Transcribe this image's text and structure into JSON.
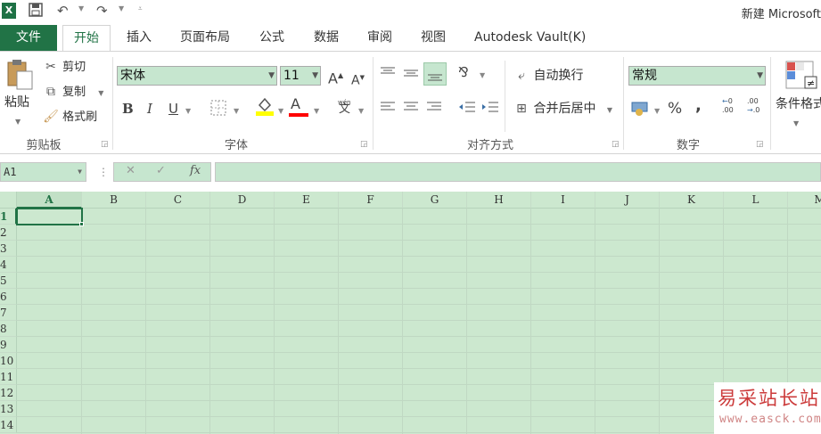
{
  "titlebar": {
    "logo": "X",
    "title": "新建 Microsoft"
  },
  "tabs": {
    "file": "文件",
    "items": [
      "开始",
      "插入",
      "页面布局",
      "公式",
      "数据",
      "审阅",
      "视图",
      "Autodesk Vault(K)"
    ]
  },
  "clipboard": {
    "paste": "粘贴",
    "cut": "剪切",
    "copy": "复制",
    "format_painter": "格式刷",
    "label": "剪贴板"
  },
  "font": {
    "name": "宋体",
    "size": "11",
    "bold": "B",
    "italic": "I",
    "underline": "U",
    "increase": "A",
    "decrease": "A",
    "font_color": "A",
    "phonetic": "文",
    "phonetic_top": "wén",
    "label": "字体"
  },
  "alignment": {
    "wrap_text": "自动换行",
    "merge_center": "合并后居中",
    "label": "对齐方式"
  },
  "number": {
    "format": "常规",
    "percent": "%",
    "comma": ",",
    "inc_decimal": ".00",
    "dec_decimal": ".00",
    "label": "数字"
  },
  "styles": {
    "conditional": "条件格式"
  },
  "formula_bar": {
    "name_box": "A1",
    "cancel": "✕",
    "enter": "✓",
    "fx": "fx",
    "dots": "⋮"
  },
  "grid": {
    "columns": [
      "A",
      "B",
      "C",
      "D",
      "E",
      "F",
      "G",
      "H",
      "I",
      "J",
      "K",
      "L",
      "M"
    ],
    "rows": [
      "1",
      "2",
      "3",
      "4",
      "5",
      "6",
      "7",
      "8",
      "9",
      "10",
      "11",
      "12",
      "13",
      "14"
    ]
  },
  "watermark": {
    "top": "易采站长站",
    "bottom": "www.easck.com"
  },
  "colors": {
    "excel_green": "#217346",
    "cell_background": "#cce8cf",
    "highlight_yellow": "#ffff00",
    "font_red": "#ff0000"
  },
  "icons": [
    "excel-logo-icon",
    "save-icon",
    "undo-icon",
    "redo-icon",
    "customize-icon",
    "paste-icon",
    "scissors-icon",
    "copy-icon",
    "brush-icon",
    "increase-font-icon",
    "decrease-font-icon",
    "border-icon",
    "fill-color-icon",
    "font-color-icon",
    "align-top-icon",
    "align-middle-icon",
    "align-bottom-icon",
    "orientation-icon",
    "align-left-icon",
    "align-center-icon",
    "align-right-icon",
    "decrease-indent-icon",
    "increase-indent-icon",
    "wrap-text-icon",
    "merge-icon",
    "currency-icon",
    "conditional-format-icon"
  ]
}
